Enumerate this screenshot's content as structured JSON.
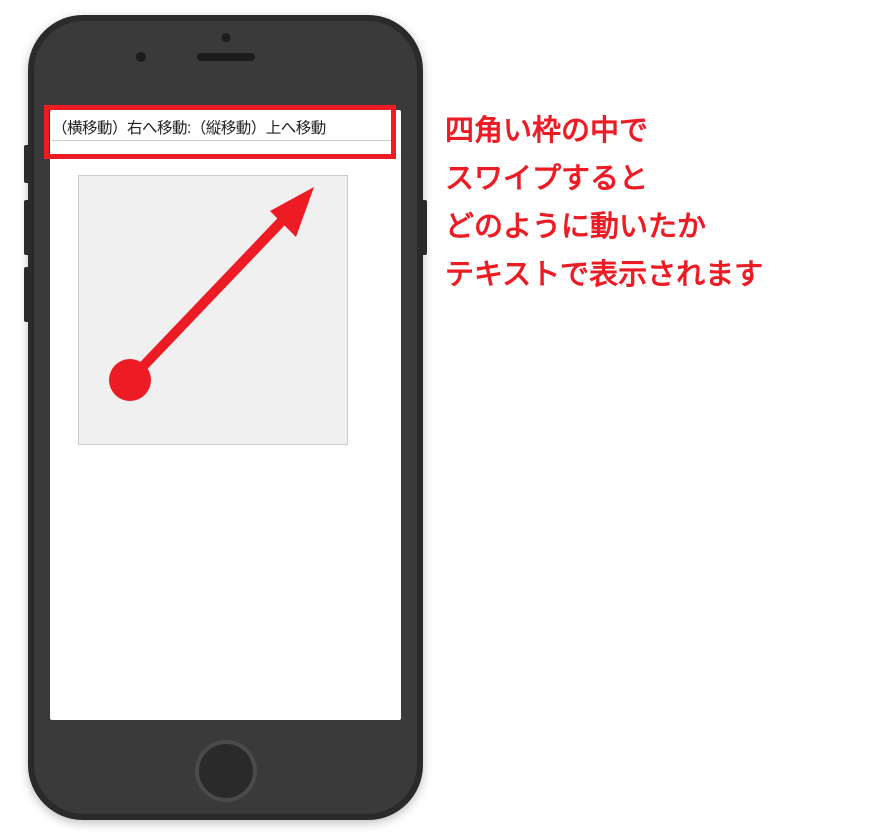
{
  "screen": {
    "status_text": "（横移動）右へ移動:（縦移動）上へ移動"
  },
  "explanation": {
    "line1": "四角い枠の中で",
    "line2": "スワイプすると",
    "line3": "どのように動いたか",
    "line4": "テキストで表示されます"
  },
  "colors": {
    "accent": "#ed1c24",
    "phone_body": "#2a2a2a",
    "phone_inner": "#3a3a3a",
    "swipe_bg": "#f0f0f0"
  }
}
